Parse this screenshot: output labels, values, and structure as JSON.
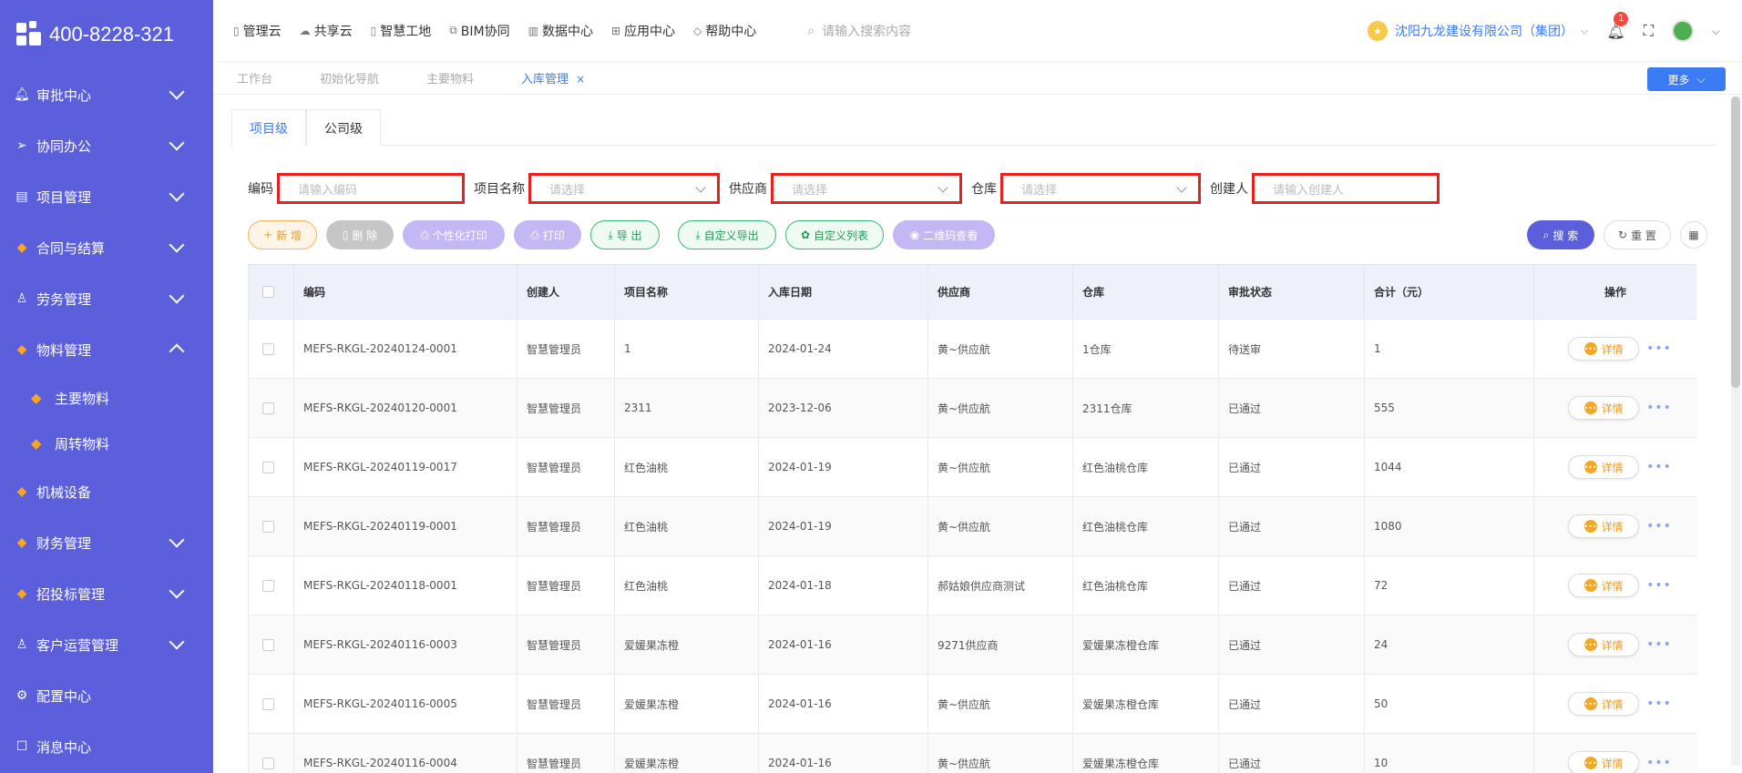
{
  "sidebar": {
    "phone": "400-8228-321",
    "items": [
      {
        "label": "审批中心",
        "icon": "bell-icon",
        "glyph": "🔔︎",
        "chevron": "down"
      },
      {
        "label": "协同办公",
        "icon": "send-icon",
        "glyph": "➢",
        "chevron": "down"
      },
      {
        "label": "项目管理",
        "icon": "book-icon",
        "glyph": "▤",
        "chevron": "down"
      },
      {
        "label": "合同与结算",
        "icon": "gem-icon",
        "glyph": "◆",
        "chevron": "down"
      },
      {
        "label": "劳务管理",
        "icon": "worker-icon",
        "glyph": "♙",
        "chevron": "down"
      },
      {
        "label": "物料管理",
        "icon": "gem-icon",
        "glyph": "◆",
        "chevron": "up"
      }
    ],
    "sub_items": [
      {
        "label": "主要物料"
      },
      {
        "label": "周转物料"
      }
    ],
    "items_after": [
      {
        "label": "机械设备",
        "icon": "gem-icon",
        "glyph": "◆",
        "chevron": ""
      },
      {
        "label": "财务管理",
        "icon": "gem-icon",
        "glyph": "◆",
        "chevron": "down"
      },
      {
        "label": "招投标管理",
        "icon": "gem-icon",
        "glyph": "◆",
        "chevron": "down"
      },
      {
        "label": "客户运营管理",
        "icon": "worker-icon",
        "glyph": "♙",
        "chevron": "down"
      },
      {
        "label": "配置中心",
        "icon": "gear-icon",
        "glyph": "⚙",
        "chevron": ""
      },
      {
        "label": "消息中心",
        "icon": "message-icon",
        "glyph": "☐",
        "chevron": ""
      }
    ]
  },
  "topbar": {
    "menus": [
      "管理云",
      "共享云",
      "智慧工地",
      "BIM协同",
      "数据中心",
      "应用中心",
      "帮助中心"
    ],
    "search_placeholder": "请输入搜索内容",
    "company": "沈阳九龙建设有限公司（集团）",
    "notification_count": "1"
  },
  "tabs": {
    "items": [
      "工作台",
      "初始化导航",
      "主要物料",
      "入库管理"
    ],
    "active": "入库管理",
    "more_label": "更多"
  },
  "level_tabs": [
    "项目级",
    "公司级"
  ],
  "filters": {
    "code_label": "编码",
    "code_placeholder": "请输入编码",
    "project_label": "项目名称",
    "project_placeholder": "请选择",
    "supplier_label": "供应商",
    "supplier_placeholder": "请选择",
    "warehouse_label": "仓库",
    "warehouse_placeholder": "请选择",
    "creator_label": "创建人",
    "creator_placeholder": "请输入创建人"
  },
  "actions": {
    "add": "新 增",
    "delete": "删 除",
    "custom_print": "个性化打印",
    "print": "打印",
    "export": "导 出",
    "custom_export": "自定义导出",
    "custom_list": "自定义列表",
    "qr_view": "二维码查看",
    "search": "搜 索",
    "reset": "重 置"
  },
  "table": {
    "columns": [
      "编码",
      "创建人",
      "项目名称",
      "入库日期",
      "供应商",
      "仓库",
      "审批状态",
      "合计（元）",
      "操作"
    ],
    "detail_label": "详情",
    "rows": [
      {
        "code": "MEFS-RKGL-20240124-0001",
        "creator": "智慧管理员",
        "project": "1",
        "date": "2024-01-24",
        "supplier": "黄~供应航",
        "warehouse": "1仓库",
        "status": "待送审",
        "total": "1"
      },
      {
        "code": "MEFS-RKGL-20240120-0001",
        "creator": "智慧管理员",
        "project": "2311",
        "date": "2023-12-06",
        "supplier": "黄~供应航",
        "warehouse": "2311仓库",
        "status": "已通过",
        "total": "555"
      },
      {
        "code": "MEFS-RKGL-20240119-0017",
        "creator": "智慧管理员",
        "project": "红色油桃",
        "date": "2024-01-19",
        "supplier": "黄~供应航",
        "warehouse": "红色油桃仓库",
        "status": "已通过",
        "total": "1044"
      },
      {
        "code": "MEFS-RKGL-20240119-0001",
        "creator": "智慧管理员",
        "project": "红色油桃",
        "date": "2024-01-19",
        "supplier": "黄~供应航",
        "warehouse": "红色油桃仓库",
        "status": "已通过",
        "total": "1080"
      },
      {
        "code": "MEFS-RKGL-20240118-0001",
        "creator": "智慧管理员",
        "project": "红色油桃",
        "date": "2024-01-18",
        "supplier": "郝姑娘供应商测试",
        "warehouse": "红色油桃仓库",
        "status": "已通过",
        "total": "72"
      },
      {
        "code": "MEFS-RKGL-20240116-0003",
        "creator": "智慧管理员",
        "project": "爱媛果冻橙",
        "date": "2024-01-16",
        "supplier": "9271供应商",
        "warehouse": "爱媛果冻橙仓库",
        "status": "已通过",
        "total": "24"
      },
      {
        "code": "MEFS-RKGL-20240116-0005",
        "creator": "智慧管理员",
        "project": "爱媛果冻橙",
        "date": "2024-01-16",
        "supplier": "黄~供应航",
        "warehouse": "爱媛果冻橙仓库",
        "status": "已通过",
        "total": "50"
      },
      {
        "code": "MEFS-RKGL-20240116-0004",
        "creator": "智慧管理员",
        "project": "爱媛果冻橙",
        "date": "2024-01-16",
        "supplier": "黄~供应航",
        "warehouse": "爱媛果冻橙仓库",
        "status": "已通过",
        "total": "10"
      }
    ]
  },
  "colors": {
    "sidebar_bg": "#5b5fdc",
    "accent": "#3b7cf4",
    "highlight_border": "#e82020",
    "orange": "#f09a20"
  }
}
